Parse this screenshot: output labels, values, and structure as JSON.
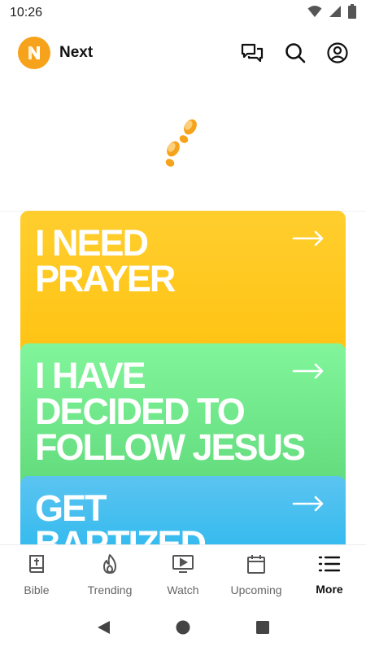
{
  "status_bar": {
    "time": "10:26"
  },
  "app": {
    "title": "Next",
    "logo_letter": "N",
    "brand_color": "#F7A21B"
  },
  "header": {
    "icons": [
      "chat-icon",
      "search-icon",
      "account-icon"
    ]
  },
  "hero": {
    "icon": "footsteps-icon"
  },
  "cards": [
    {
      "title": "I NEED\nPRAYER",
      "color": "#FFC312",
      "arrow": "arrow-right-icon"
    },
    {
      "title": "I HAVE\nDECIDED TO\nFOLLOW JESUS",
      "color": "#5FD97A",
      "arrow": "arrow-right-icon"
    },
    {
      "title": "GET\nBAPTIZED",
      "color": "#27B7EE",
      "arrow": "arrow-right-icon"
    }
  ],
  "bottom_nav": {
    "items": [
      {
        "label": "Bible",
        "icon": "bible-icon"
      },
      {
        "label": "Trending",
        "icon": "flame-icon"
      },
      {
        "label": "Watch",
        "icon": "play-screen-icon"
      },
      {
        "label": "Upcoming",
        "icon": "calendar-icon"
      },
      {
        "label": "More",
        "icon": "menu-list-icon",
        "active": true
      }
    ]
  }
}
